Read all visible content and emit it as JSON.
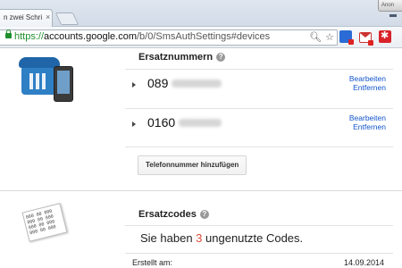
{
  "browser": {
    "tab_title": "n zwei Schri",
    "tab_close": "×",
    "profile_label": "Anon",
    "url_protocol": "https://",
    "url_host": "accounts.google.com",
    "url_path": "/b/0/SmsAuthSettings#devices",
    "omnibox_icons": [
      "search-icon",
      "star-icon"
    ],
    "extensions": [
      "extension-blue-icon",
      "gmail-notifier-icon",
      "extension-red-icon"
    ]
  },
  "backup_numbers": {
    "title": "Ersatznummern",
    "help": "?",
    "numbers": [
      {
        "prefix": "089",
        "edit_label": "Bearbeiten",
        "remove_label": "Entfernen"
      },
      {
        "prefix": "0160",
        "edit_label": "Bearbeiten",
        "remove_label": "Entfernen"
      }
    ],
    "add_button": "Telefonnummer hinzufügen"
  },
  "backup_codes": {
    "title": "Ersatzcodes",
    "help": "?",
    "illustration_lines": [
      "000 00 000",
      "000 00 000",
      "000 00 000",
      "000 00 000"
    ],
    "unused_prefix": "Sie haben ",
    "unused_count": "3",
    "unused_suffix": " ungenutzte Codes.",
    "created_label": "Erstellt am:",
    "created_date": "14.09.2014"
  },
  "colors": {
    "link": "#1155cc",
    "count": "#dd4b39",
    "secure": "#1d8f2d"
  }
}
